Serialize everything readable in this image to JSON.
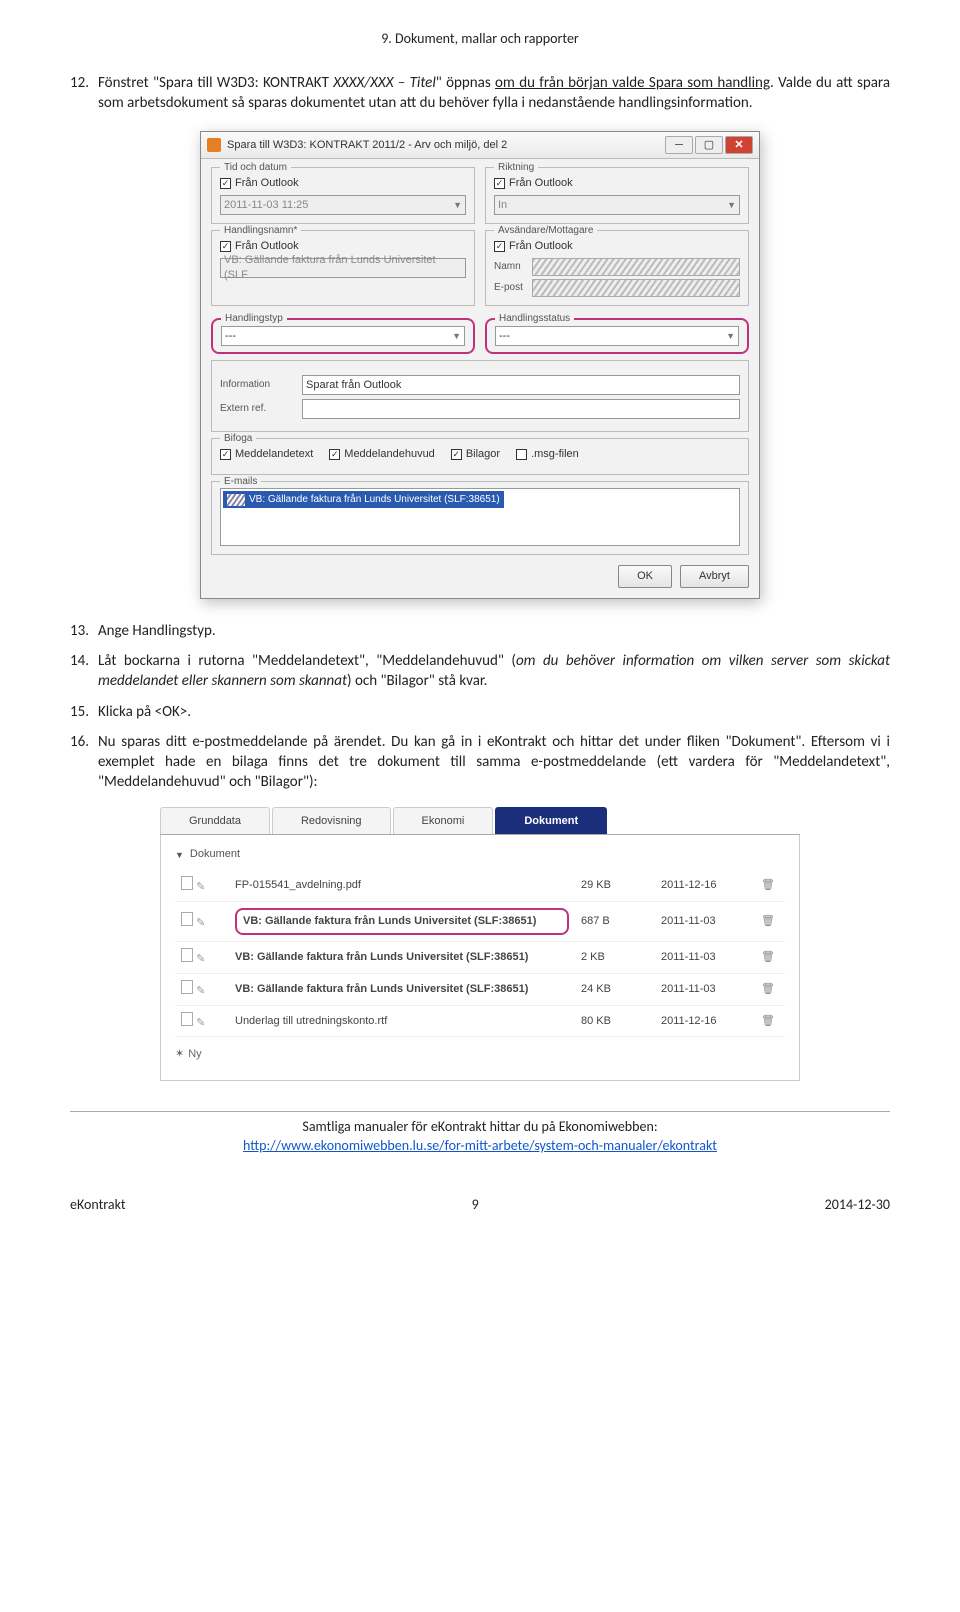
{
  "header": {
    "section_title": "9. Dokument, mallar och rapporter"
  },
  "items": {
    "p12_num": "12.",
    "p12a": "Fönstret \"Spara till W3D3: KONTRAKT ",
    "p12b": "XXXX/XXX – Titel",
    "p12c": "\" öppnas ",
    "p12d": "om du från början valde Spara som handling",
    "p12e": ". Valde du att spara som arbetsdokument så sparas dokumentet utan att du behöver fylla i nedanstående handlingsinformation.",
    "p13_num": "13.",
    "p13": "Ange Handlingstyp.",
    "p14_num": "14.",
    "p14a": "Låt bockarna i rutorna \"Meddelandetext\", \"Meddelandehuvud\" (",
    "p14b": "om du behöver information om vilken server som skickat meddelandet eller skannern som skannat",
    "p14c": ") och \"Bilagor\" stå kvar.",
    "p15_num": "15.",
    "p15": "Klicka på <OK>.",
    "p16_num": "16.",
    "p16": "Nu sparas ditt e-postmeddelande på ärendet. Du kan gå in i eKontrakt och hittar det under fliken \"Dokument\". Eftersom vi i exemplet hade en bilaga finns det tre dokument till samma e-postmeddelande (ett vardera för \"Meddelandetext\", \"Meddelandehuvud\" och \"Bilagor\"):"
  },
  "dialog": {
    "title": "Spara till W3D3: KONTRAKT 2011/2 - Arv och miljö, del 2",
    "groups": {
      "tid": "Tid och datum",
      "riktning": "Riktning",
      "handlingsnamn": "Handlingsnamn*",
      "avs": "Avsändare/Mottagare",
      "handlingstyp": "Handlingstyp",
      "handlingsstatus": "Handlingsstatus",
      "bifoga": "Bifoga",
      "emails": "E-mails"
    },
    "labels": {
      "fran_outlook": "Från Outlook",
      "namn": "Namn",
      "epost": "E-post",
      "information": "Information",
      "extern_ref": "Extern ref.",
      "in": "In"
    },
    "values": {
      "datum": "2011-11-03 11:25",
      "namn_val": "VB: Gällande faktura från Lunds Universitet (SLF",
      "info_val": "Sparat från Outlook",
      "dash": "---",
      "email_sel": "VB: Gällande faktura från Lunds Universitet (SLF:38651)"
    },
    "bifoga": {
      "meddelandetext": "Meddelandetext",
      "meddelandehuvud": "Meddelandehuvud",
      "bilagor": "Bilagor",
      "msg": ".msg-filen"
    },
    "buttons": {
      "ok": "OK",
      "avbryt": "Avbryt"
    }
  },
  "tabs_shot": {
    "tabs": {
      "grund": "Grunddata",
      "red": "Redovisning",
      "eko": "Ekonomi",
      "dok": "Dokument"
    },
    "section": "Dokument",
    "rows": [
      {
        "name": "FP-015541_avdelning.pdf",
        "size": "29 KB",
        "date": "2011-12-16",
        "bold": false,
        "hl": false
      },
      {
        "name": "VB: Gällande faktura från Lunds Universitet (SLF:38651)",
        "size": "687 B",
        "date": "2011-11-03",
        "bold": true,
        "hl": true
      },
      {
        "name": "VB: Gällande faktura från Lunds Universitet (SLF:38651)",
        "size": "2 KB",
        "date": "2011-11-03",
        "bold": true,
        "hl": false
      },
      {
        "name": "VB: Gällande faktura från Lunds Universitet (SLF:38651)",
        "size": "24 KB",
        "date": "2011-11-03",
        "bold": true,
        "hl": false
      },
      {
        "name": "Underlag till utredningskonto.rtf",
        "size": "80 KB",
        "date": "2011-12-16",
        "bold": false,
        "hl": false
      }
    ],
    "ny": "Ny"
  },
  "footer": {
    "line1": "Samtliga manualer för eKontrakt hittar du på Ekonomiwebben:",
    "link": "http://www.ekonomiwebben.lu.se/for-mitt-arbete/system-och-manualer/ekontrakt"
  },
  "page_foot": {
    "left": "eKontrakt",
    "center": "9",
    "right": "2014-12-30"
  }
}
